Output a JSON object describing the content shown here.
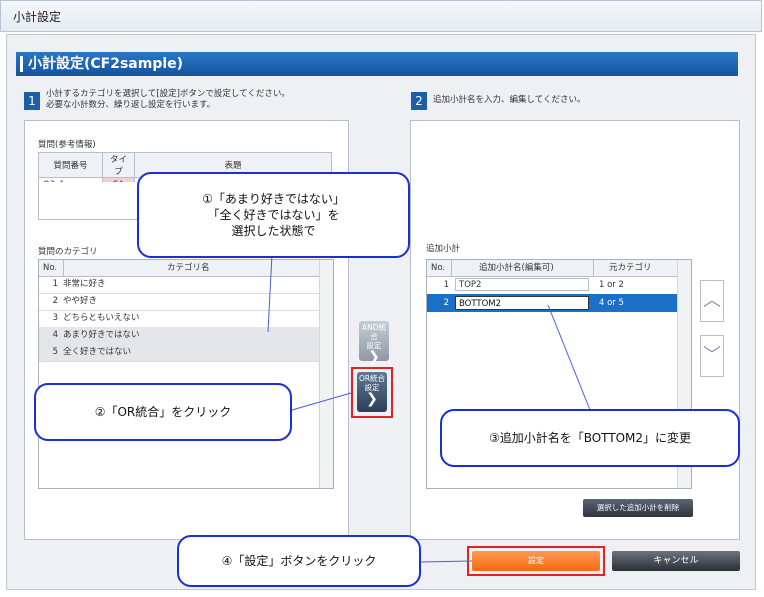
{
  "window": {
    "title": "小計設定"
  },
  "section": {
    "title": "小計設定(CF2sample)"
  },
  "step1": {
    "num": "1",
    "line1": "小計するカテゴリを選択して[設定]ボタンで設定してください。",
    "line2": "必要な小計数分、繰り返し設定を行います。"
  },
  "step2": {
    "num": "2",
    "text": "追加小計名を入力、編集してください。"
  },
  "question": {
    "label": "質問(参考情報)",
    "headers": [
      "質問番号",
      "タイプ",
      "表題"
    ],
    "row": [
      "Q3_1",
      "SA",
      ""
    ]
  },
  "categories": {
    "label": "質問のカテゴリ",
    "headers": [
      "No.",
      "カテゴリ名"
    ],
    "rows": [
      {
        "no": "1",
        "name": "非常に好き"
      },
      {
        "no": "2",
        "name": "やや好き"
      },
      {
        "no": "3",
        "name": "どちらともいえない"
      },
      {
        "no": "4",
        "name": "あまり好きではない"
      },
      {
        "no": "5",
        "name": "全く好きではない"
      }
    ]
  },
  "buttons": {
    "and_merge": [
      "AND統合",
      "設定"
    ],
    "or_merge": [
      "OR統合",
      "設定"
    ],
    "delete_selected": "選択した追加小計を削除",
    "set": "設定",
    "cancel": "キャンセル",
    "chevron_right": "❯",
    "up": "︿",
    "down": "﹀"
  },
  "additional": {
    "label": "追加小計",
    "headers": [
      "No.",
      "追加小計名(編集可)",
      "元カテゴリ"
    ],
    "rows": [
      {
        "no": "1",
        "name": "TOP2",
        "source": "1 or 2"
      },
      {
        "no": "2",
        "name": "BOTTOM2",
        "source": "4 or 5"
      }
    ]
  },
  "callouts": {
    "c1": [
      "①「あまり好きではない」",
      "「全く好きではない」を",
      "選択した状態で"
    ],
    "c2": "②「OR統合」をクリック",
    "c3": "③追加小計名を「BOTTOM2」に変更",
    "c4": "④「設定」ボタンをクリック"
  },
  "colors": {
    "accent": "#14539f",
    "selected_row": "#1a6fc7",
    "callout_border": "#1b2fd6",
    "highlight": "#e02424",
    "set_button": "#f46a14"
  }
}
